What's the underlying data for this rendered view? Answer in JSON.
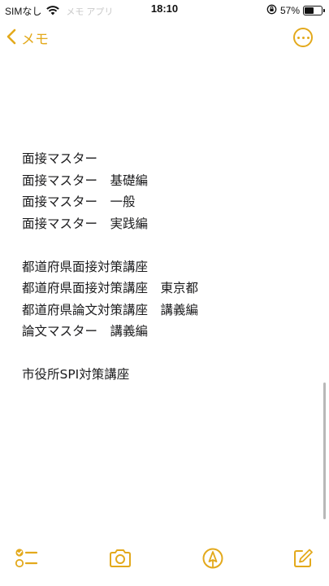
{
  "status_bar": {
    "carrier": "SIMなし",
    "ghost_text": "メモ アプリ",
    "time": "18:10",
    "battery_percent": "57%",
    "battery_level": 0.57
  },
  "nav": {
    "back_label": "メモ",
    "back_icon": "chevron-left-icon",
    "more_icon": "ellipsis-circle-icon",
    "accent_color": "#e3a91c"
  },
  "note": {
    "lines": [
      "面接マスター",
      "面接マスター　基礎編",
      "面接マスター　一般",
      "面接マスター　実践編",
      "",
      "都道府県面接対策講座",
      "都道府県面接対策講座　東京都",
      "都道府県論文対策講座　講義編",
      "論文マスター　講義編",
      "",
      "市役所SPI対策講座"
    ]
  },
  "toolbar": {
    "items": [
      {
        "icon": "checklist-icon"
      },
      {
        "icon": "camera-icon"
      },
      {
        "icon": "markup-pen-icon"
      },
      {
        "icon": "compose-icon"
      }
    ]
  }
}
